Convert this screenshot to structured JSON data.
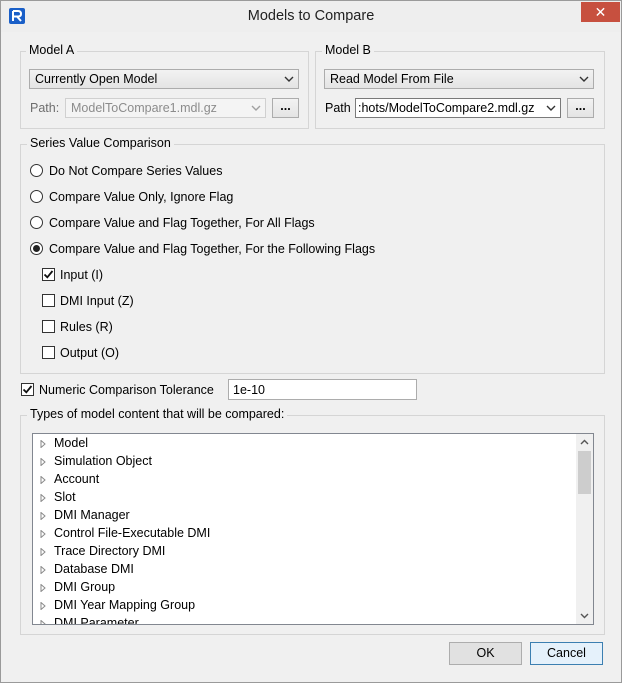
{
  "window": {
    "title": "Models to Compare",
    "close_glyph": "✕"
  },
  "model_a": {
    "group_title": "Model A",
    "source_selected": "Currently Open Model",
    "path_label": "Path:",
    "path_value": "ModelToCompare1.mdl.gz",
    "browse_label": "..."
  },
  "model_b": {
    "group_title": "Model B",
    "source_selected": "Read Model From File",
    "path_label": "Path",
    "path_value": ":hots/ModelToCompare2.mdl.gz",
    "browse_label": "..."
  },
  "series": {
    "group_title": "Series Value Comparison",
    "options": [
      {
        "label": "Do Not Compare Series Values",
        "selected": false
      },
      {
        "label": "Compare Value Only, Ignore Flag",
        "selected": false
      },
      {
        "label": "Compare Value and Flag Together, For All Flags",
        "selected": false
      },
      {
        "label": "Compare Value and Flag Together, For the Following Flags",
        "selected": true
      }
    ],
    "flags": [
      {
        "label": "Input (I)",
        "checked": true
      },
      {
        "label": "DMI Input (Z)",
        "checked": false
      },
      {
        "label": "Rules (R)",
        "checked": false
      },
      {
        "label": "Output (O)",
        "checked": false
      }
    ]
  },
  "tolerance": {
    "label": "Numeric Comparison Tolerance",
    "checked": true,
    "value": "1e-10"
  },
  "content_types": {
    "group_title": "Types of model content that will be compared:",
    "items": [
      "Model",
      "Simulation Object",
      "Account",
      "Slot",
      "DMI Manager",
      "Control File-Executable DMI",
      "Trace Directory DMI",
      "Database DMI",
      "DMI Group",
      "DMI Year Mapping Group",
      "DMI Parameter"
    ]
  },
  "buttons": {
    "ok": "OK",
    "cancel": "Cancel"
  },
  "colors": {
    "accent": "#1a5fc8",
    "close": "#c7503f",
    "default_button_border": "#3c7fb1"
  }
}
